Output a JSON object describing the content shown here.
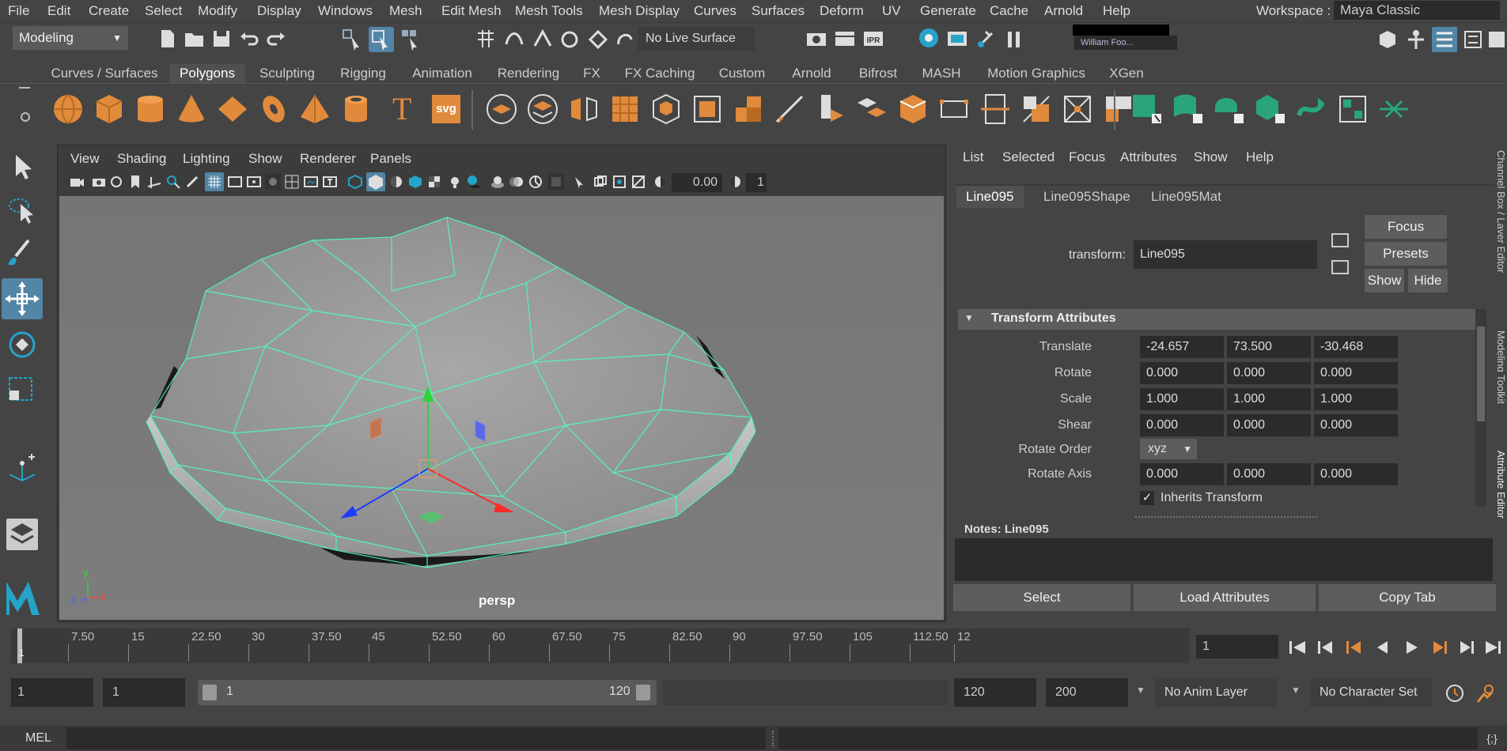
{
  "menubar": {
    "items": [
      "File",
      "Edit",
      "Create",
      "Select",
      "Modify",
      "Display",
      "Windows",
      "Mesh",
      "Edit Mesh",
      "Mesh Tools",
      "Mesh Display",
      "Curves",
      "Surfaces",
      "Deform",
      "UV",
      "Generate",
      "Cache",
      "Arnold",
      "Help"
    ],
    "workspace_label": "Workspace :",
    "workspace_value": "Maya Classic"
  },
  "statusline": {
    "mode": "Modeling",
    "live_surface": "No Live Surface",
    "ipr_label": "IPR",
    "user": "William Foo..."
  },
  "shelf": {
    "tabs": [
      "Curves / Surfaces",
      "Polygons",
      "Sculpting",
      "Rigging",
      "Animation",
      "Rendering",
      "FX",
      "FX Caching",
      "Custom",
      "Arnold",
      "Bifrost",
      "MASH",
      "Motion Graphics",
      "XGen"
    ],
    "active_tab": "Polygons",
    "text_icon": "T",
    "svg_icon": "svg"
  },
  "viewport": {
    "menus": [
      "View",
      "Shading",
      "Lighting",
      "Show",
      "Renderer",
      "Panels"
    ],
    "exposure": "0.00",
    "gamma_partial": "1",
    "camera": "persp",
    "axis_x": "x",
    "axis_y": "y",
    "axis_z": "z"
  },
  "attribute_editor": {
    "menus": [
      "List",
      "Selected",
      "Focus",
      "Attributes",
      "Show",
      "Help"
    ],
    "tabs": [
      "Line095",
      "Line095Shape",
      "Line095Mat"
    ],
    "transform_label": "transform:",
    "transform_value": "Line095",
    "focus_btn": "Focus",
    "presets_btn": "Presets",
    "show_btn": "Show",
    "hide_btn": "Hide",
    "section_title": "Transform Attributes",
    "attrs": [
      {
        "label": "Translate",
        "x": "-24.657",
        "y": "73.500",
        "z": "-30.468"
      },
      {
        "label": "Rotate",
        "x": "0.000",
        "y": "0.000",
        "z": "0.000"
      },
      {
        "label": "Scale",
        "x": "1.000",
        "y": "1.000",
        "z": "1.000"
      },
      {
        "label": "Shear",
        "x": "0.000",
        "y": "0.000",
        "z": "0.000"
      }
    ],
    "rotate_order_label": "Rotate Order",
    "rotate_order_value": "xyz",
    "rotate_axis": {
      "label": "Rotate Axis",
      "x": "0.000",
      "y": "0.000",
      "z": "0.000"
    },
    "inherits_label": "Inherits Transform",
    "inherits_checked": true,
    "notes_label": "Notes:  Line095",
    "select_btn": "Select",
    "load_btn": "Load Attributes",
    "copy_btn": "Copy Tab",
    "side_tabs": [
      "Channel Box / Layer Editor",
      "Modeling Toolkit",
      "Attribute Editor"
    ]
  },
  "timeline": {
    "ticks": [
      "7.50",
      "15",
      "22.50",
      "30",
      "37.50",
      "45",
      "52.50",
      "60",
      "67.50",
      "75",
      "82.50",
      "90",
      "97.50",
      "105",
      "112.50",
      "12"
    ],
    "current_marker": "1",
    "current_frame": "1"
  },
  "range": {
    "start": "1",
    "playback_start": "1",
    "slider_start": "1",
    "slider_end": "120",
    "playback_end": "120",
    "end": "200",
    "anim_layer": "No Anim Layer",
    "character_set": "No Character Set"
  },
  "cmdline": {
    "label": "MEL"
  }
}
